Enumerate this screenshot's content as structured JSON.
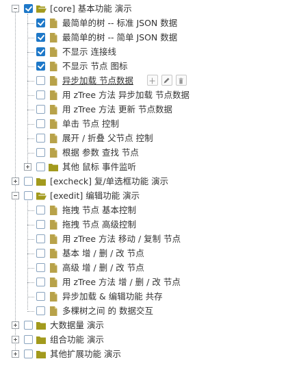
{
  "tree": {
    "nodes": [
      {
        "label": "[core] 基本功能 演示",
        "type": "folder-open",
        "checked": true,
        "switch": "minus"
      },
      {
        "label": "最简单的树 -- 标准 JSON 数据",
        "type": "file",
        "checked": true
      },
      {
        "label": "最简单的树 -- 简单 JSON 数据",
        "type": "file",
        "checked": true
      },
      {
        "label": "不显示 连接线",
        "type": "file",
        "checked": true
      },
      {
        "label": "不显示 节点 图标",
        "type": "file",
        "checked": true
      },
      {
        "label": "异步加载 节点数据",
        "type": "file",
        "checked": false,
        "hovered": true
      },
      {
        "label": "用 zTree 方法 异步加载 节点数据",
        "type": "file",
        "checked": false
      },
      {
        "label": "用 zTree 方法 更新 节点数据",
        "type": "file",
        "checked": false
      },
      {
        "label": "单击 节点 控制",
        "type": "file",
        "checked": false
      },
      {
        "label": "展开 / 折叠 父节点 控制",
        "type": "file",
        "checked": false
      },
      {
        "label": "根据 参数 查找 节点",
        "type": "file",
        "checked": false
      },
      {
        "label": "其他 鼠标 事件监听",
        "type": "folder",
        "checked": false,
        "switch": "plus"
      },
      {
        "label": "[excheck] 复/单选框功能 演示",
        "type": "folder",
        "checked": false,
        "switch": "plus"
      },
      {
        "label": "[exedit] 编辑功能 演示",
        "type": "folder-open",
        "checked": false,
        "switch": "minus"
      },
      {
        "label": "拖拽 节点 基本控制",
        "type": "file",
        "checked": false
      },
      {
        "label": "拖拽 节点 高级控制",
        "type": "file",
        "checked": false
      },
      {
        "label": "用 zTree 方法 移动 / 复制 节点",
        "type": "file",
        "checked": false
      },
      {
        "label": "基本 增 / 删 / 改 节点",
        "type": "file",
        "checked": false
      },
      {
        "label": "高级 增 / 删 / 改 节点",
        "type": "file",
        "checked": false
      },
      {
        "label": "用 zTree 方法 增 / 删 / 改 节点",
        "type": "file",
        "checked": false
      },
      {
        "label": "异步加载 & 编辑功能 共存",
        "type": "file",
        "checked": false
      },
      {
        "label": "多棵树之间 的 数据交互",
        "type": "file",
        "checked": false
      },
      {
        "label": "大数据量 演示",
        "type": "folder",
        "checked": false,
        "switch": "plus"
      },
      {
        "label": "组合功能 演示",
        "type": "folder",
        "checked": false,
        "switch": "plus"
      },
      {
        "label": "其他扩展功能 演示",
        "type": "folder",
        "checked": false,
        "switch": "plus"
      }
    ],
    "hover_buttons": {
      "add": "add-icon",
      "edit": "pencil-icon",
      "remove": "trash-icon"
    },
    "colors": {
      "checkbox_checked": "#1e78c8",
      "checkbox_border": "#8aa4bf",
      "folder": "#a29a1d",
      "file": "#b8a24a",
      "line": "#9aa0a6"
    }
  }
}
